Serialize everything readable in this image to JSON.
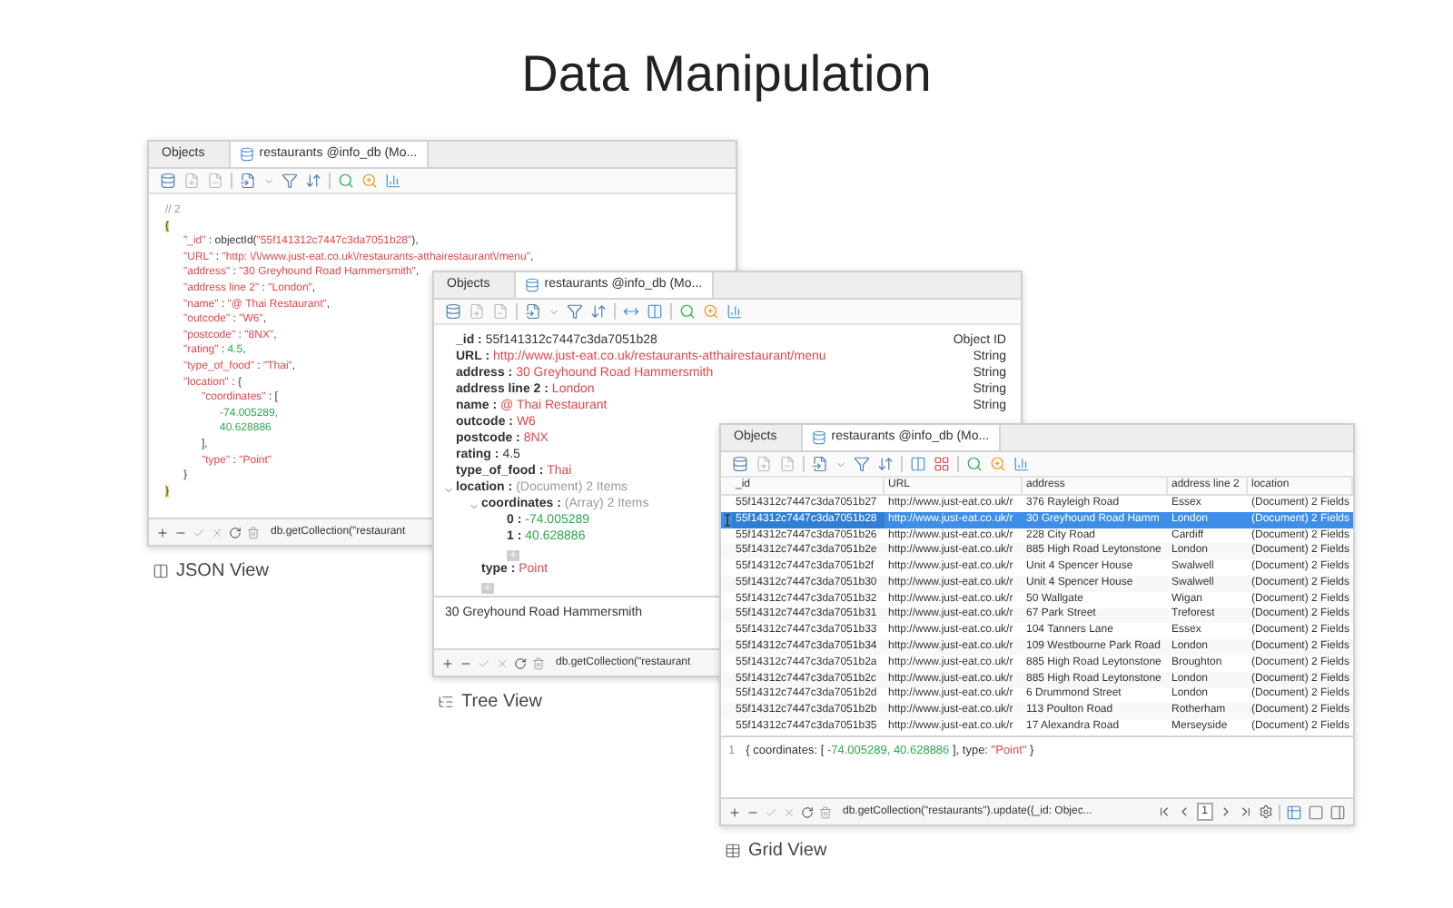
{
  "title": "Data Manipulation",
  "json_view": {
    "caption": "JSON View",
    "tabs": [
      {
        "label": "Objects",
        "selected": false
      },
      {
        "label": "restaurants @info_db (Mo...",
        "selected": true
      }
    ],
    "lines": [
      {
        "parts": [
          {
            "text": "// 2",
            "kind": "comment"
          }
        ]
      },
      {
        "parts": [
          {
            "text": "{",
            "kind": "brace"
          }
        ],
        "children": [
          {
            "parts": [
              {
                "text": "\"_id\"",
                "kind": "key"
              },
              {
                "text": " : objectId(",
                "kind": "plain"
              },
              {
                "text": "\"55f141312c7447c3da7051b28\"",
                "kind": "string"
              },
              {
                "text": "),",
                "kind": "plain"
              }
            ]
          },
          {
            "parts": [
              {
                "text": "\"URL\"",
                "kind": "key"
              },
              {
                "text": " : ",
                "kind": "plain"
              },
              {
                "text": "\"http: \\/\\/www.just-eat.co.uk\\/restaurants-atthairestaurant\\/menu\"",
                "kind": "string"
              },
              {
                "text": ",",
                "kind": "plain"
              }
            ]
          },
          {
            "parts": [
              {
                "text": "\"address\"",
                "kind": "key"
              },
              {
                "text": " : ",
                "kind": "plain"
              },
              {
                "text": "\"30 Greyhound Road Hammersmith\"",
                "kind": "string"
              },
              {
                "text": ",",
                "kind": "plain"
              }
            ]
          },
          {
            "parts": [
              {
                "text": "\"address line 2\"",
                "kind": "key"
              },
              {
                "text": " : ",
                "kind": "plain"
              },
              {
                "text": "\"London\"",
                "kind": "string"
              },
              {
                "text": ",",
                "kind": "plain"
              }
            ]
          },
          {
            "parts": [
              {
                "text": "\"name\"",
                "kind": "key"
              },
              {
                "text": " : ",
                "kind": "plain"
              },
              {
                "text": "\"@ Thai Restaurant\"",
                "kind": "string"
              },
              {
                "text": ",",
                "kind": "plain"
              }
            ]
          },
          {
            "parts": [
              {
                "text": "\"outcode\"",
                "kind": "key"
              },
              {
                "text": " : ",
                "kind": "plain"
              },
              {
                "text": "\"W6\"",
                "kind": "string"
              },
              {
                "text": ",",
                "kind": "plain"
              }
            ]
          },
          {
            "parts": [
              {
                "text": "\"postcode\"",
                "kind": "key"
              },
              {
                "text": " : ",
                "kind": "plain"
              },
              {
                "text": "\"8NX\"",
                "kind": "string"
              },
              {
                "text": ",",
                "kind": "plain"
              }
            ]
          },
          {
            "parts": [
              {
                "text": "\"rating\"",
                "kind": "key"
              },
              {
                "text": " : ",
                "kind": "plain"
              },
              {
                "text": "4.5",
                "kind": "number"
              },
              {
                "text": ",",
                "kind": "plain"
              }
            ]
          },
          {
            "parts": [
              {
                "text": "\"type_of_food\"",
                "kind": "key"
              },
              {
                "text": " : ",
                "kind": "plain"
              },
              {
                "text": "\"Thai\"",
                "kind": "string"
              },
              {
                "text": ",",
                "kind": "plain"
              }
            ]
          },
          {
            "parts": [
              {
                "text": "\"location\"",
                "kind": "key"
              },
              {
                "text": " : {",
                "kind": "plain"
              }
            ],
            "children": [
              {
                "parts": [
                  {
                    "text": "\"coordinates\"",
                    "kind": "key"
                  },
                  {
                    "text": " : [",
                    "kind": "plain"
                  }
                ],
                "children": [
                  {
                    "parts": [
                      {
                        "text": "-74.005289,",
                        "kind": "number"
                      }
                    ]
                  },
                  {
                    "parts": [
                      {
                        "text": "40.628886",
                        "kind": "number"
                      }
                    ]
                  }
                ]
              },
              {
                "parts": [
                  {
                    "text": "],",
                    "kind": "plain"
                  }
                ]
              },
              {
                "parts": [
                  {
                    "text": "\"type\"",
                    "kind": "key"
                  },
                  {
                    "text": " : ",
                    "kind": "plain"
                  },
                  {
                    "text": "\"Point\"",
                    "kind": "string"
                  }
                ]
              }
            ]
          },
          {
            "parts": [
              {
                "text": "}",
                "kind": "plain"
              }
            ]
          }
        ]
      },
      {
        "parts": [
          {
            "text": "}",
            "kind": "brace"
          }
        ]
      }
    ],
    "command": "db.getCollection(\"restaurant"
  },
  "tree_view": {
    "caption": "Tree View",
    "tabs": [
      {
        "label": "Objects",
        "selected": false
      },
      {
        "label": "restaurants @info_db (Mo...",
        "selected": true
      }
    ],
    "nodes": [
      {
        "label": "_id :",
        "value": "55f141312c7447c3da7051b28",
        "kind": "plain",
        "type": "Object ID"
      },
      {
        "label": "URL :",
        "value": "http://www.just-eat.co.uk/restaurants-atthairestaurant/menu",
        "kind": "string",
        "type": "String"
      },
      {
        "label": "address :",
        "value": "30 Greyhound Road Hammersmith",
        "kind": "string",
        "type": "String"
      },
      {
        "label": "address line 2 :",
        "value": "London",
        "kind": "string",
        "type": "String"
      },
      {
        "label": "name :",
        "value": "@ Thai Restaurant",
        "kind": "string",
        "type": "String"
      },
      {
        "label": "outcode :",
        "value": "W6",
        "kind": "string"
      },
      {
        "label": "postcode :",
        "value": "8NX",
        "kind": "string"
      },
      {
        "label": "rating :",
        "value": "4.5",
        "kind": "plain"
      },
      {
        "label": "type_of_food :",
        "value": "Thai",
        "kind": "string"
      },
      {
        "label": "location :",
        "value": "(Document) 2 Items",
        "kind": "meta",
        "expanded": true,
        "children": [
          {
            "label": "coordinates :",
            "value": "(Array) 2 Items",
            "kind": "meta",
            "expanded": true,
            "children": [
              {
                "label": "0 :",
                "value": "-74.005289",
                "kind": "number"
              },
              {
                "label": "1 :",
                "value": "40.628886",
                "kind": "number"
              }
            ]
          },
          {
            "label": "type :",
            "value": "Point",
            "kind": "string"
          }
        ]
      }
    ],
    "detail": "30 Greyhound Road Hammersmith",
    "command": "db.getCollection(\"restaurant"
  },
  "grid_view": {
    "caption": "Grid View",
    "tabs": [
      {
        "label": "Objects",
        "selected": false
      },
      {
        "label": "restaurants @info_db (Mo...",
        "selected": true
      }
    ],
    "columns": [
      "_id",
      "URL",
      "address",
      "address line 2",
      "location"
    ],
    "rows": [
      {
        "cells": [
          "55f14312c7447c3da7051b27",
          "http://www.just-eat.co.uk/r",
          "376 Rayleigh Road",
          "Essex",
          "(Document) 2 Fields"
        ],
        "selected": false
      },
      {
        "cells": [
          "55f14312c7447c3da7051b28",
          "http://www.just-eat.co.uk/r",
          "30 Greyhound Road Hamm",
          "London",
          "(Document) 2 Fields"
        ],
        "selected": true
      },
      {
        "cells": [
          "55f14312c7447c3da7051b26",
          "http://www.just-eat.co.uk/r",
          "228 City Road",
          "Cardiff",
          "(Document) 2 Fields"
        ],
        "selected": false
      },
      {
        "cells": [
          "55f14312c7447c3da7051b2e",
          "http://www.just-eat.co.uk/r",
          "885 High Road Leytonstone",
          "London",
          "(Document) 2 Fields"
        ],
        "selected": false
      },
      {
        "cells": [
          "55f14312c7447c3da7051b2f",
          "http://www.just-eat.co.uk/r",
          "Unit 4 Spencer House",
          "Swalwell",
          "(Document) 2 Fields"
        ],
        "selected": false
      },
      {
        "cells": [
          "55f14312c7447c3da7051b30",
          "http://www.just-eat.co.uk/r",
          "Unit 4 Spencer House",
          "Swalwell",
          "(Document) 2 Fields"
        ],
        "selected": false
      },
      {
        "cells": [
          "55f14312c7447c3da7051b32",
          "http://www.just-eat.co.uk/r",
          "50 Wallgate",
          "Wigan",
          "(Document) 2 Fields"
        ],
        "selected": false
      },
      {
        "cells": [
          "55f14312c7447c3da7051b31",
          "http://www.just-eat.co.uk/r",
          "67 Park Street",
          "Treforest",
          "(Document) 2 Fields"
        ],
        "selected": false
      },
      {
        "cells": [
          "55f14312c7447c3da7051b33",
          "http://www.just-eat.co.uk/r",
          "104 Tanners Lane",
          "Essex",
          "(Document) 2 Fields"
        ],
        "selected": false
      },
      {
        "cells": [
          "55f14312c7447c3da7051b34",
          "http://www.just-eat.co.uk/r",
          "109 Westbourne Park Road",
          "London",
          "(Document) 2 Fields"
        ],
        "selected": false
      },
      {
        "cells": [
          "55f14312c7447c3da7051b2a",
          "http://www.just-eat.co.uk/r",
          "885 High Road Leytonstone",
          "Broughton",
          "(Document) 2 Fields"
        ],
        "selected": false
      },
      {
        "cells": [
          "55f14312c7447c3da7051b2c",
          "http://www.just-eat.co.uk/r",
          "885 High Road Leytonstone",
          "London",
          "(Document) 2 Fields"
        ],
        "selected": false
      },
      {
        "cells": [
          "55f14312c7447c3da7051b2d",
          "http://www.just-eat.co.uk/r",
          "6 Drummond Street",
          "London",
          "(Document) 2 Fields"
        ],
        "selected": false
      },
      {
        "cells": [
          "55f14312c7447c3da7051b2b",
          "http://www.just-eat.co.uk/r",
          "113 Poulton Road",
          "Rotherham",
          "(Document) 2 Fields"
        ],
        "selected": false
      },
      {
        "cells": [
          "55f14312c7447c3da7051b35",
          "http://www.just-eat.co.uk/r",
          "17 Alexandra Road",
          "Merseyside",
          "(Document) 2 Fields"
        ],
        "selected": false
      }
    ],
    "detail": {
      "line_number": "1",
      "parts": [
        {
          "text": "{ coordinates: [ ",
          "kind": "plain"
        },
        {
          "text": "-74.005289, 40.628886",
          "kind": "number"
        },
        {
          "text": " ], type: ",
          "kind": "plain"
        },
        {
          "text": "\"Point\"",
          "kind": "string"
        },
        {
          "text": " }",
          "kind": "plain"
        }
      ]
    },
    "command": "db.getCollection(\"restaurants\").update({_id: Objec...",
    "page": "1"
  }
}
